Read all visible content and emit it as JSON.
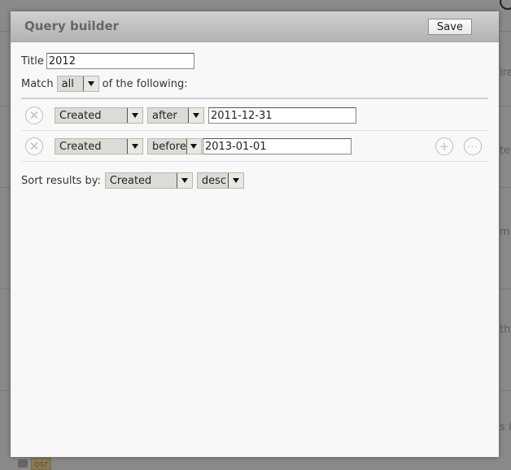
{
  "background": {
    "fragments": [
      "ire",
      "ten",
      "m",
      "th",
      "s i"
    ],
    "tag_label": "osr"
  },
  "dialog": {
    "title": "Query builder",
    "save_label": "Save",
    "title_label": "Title",
    "title_value": "2012",
    "match_label": "Match",
    "match_value": "all",
    "match_suffix": "of the following:",
    "conditions": [
      {
        "field": "Created",
        "operator": "after",
        "value": "2011-12-31"
      },
      {
        "field": "Created",
        "operator": "before",
        "value": "2013-01-01"
      }
    ],
    "sort_label": "Sort results by:",
    "sort_field": "Created",
    "sort_order": "desc"
  },
  "icons": {
    "remove": "remove-circle-icon",
    "add": "add-circle-icon",
    "more": "more-circle-icon"
  }
}
